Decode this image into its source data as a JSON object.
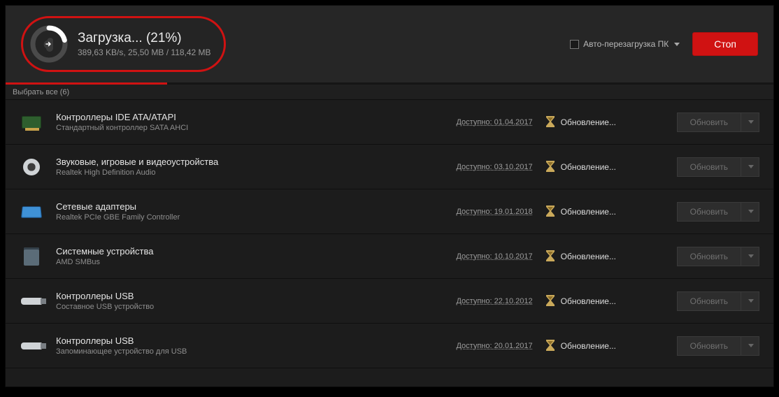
{
  "header": {
    "title": "Загрузка... (21%)",
    "meta": "389,63 KB/s, 25,50 MB / 118,42 MB",
    "progress_percent": 21,
    "auto_restart_label": "Авто-перезагрузка ПК",
    "stop_label": "Стоп"
  },
  "select_all": "Выбрать все (6)",
  "avail_prefix": "Доступно: ",
  "status_label": "Обновление...",
  "update_btn_label": "Обновить",
  "rows": [
    {
      "icon": "card",
      "title": "Контроллеры IDE ATA/ATAPI",
      "sub": "Стандартный контроллер SATA AHCI",
      "date": "01.04.2017"
    },
    {
      "icon": "speaker",
      "title": "Звуковые, игровые и видеоустройства",
      "sub": "Realtek High Definition Audio",
      "date": "03.10.2017"
    },
    {
      "icon": "nic",
      "title": "Сетевые адаптеры",
      "sub": "Realtek PCIe GBE Family Controller",
      "date": "19.01.2018"
    },
    {
      "icon": "sys",
      "title": "Системные устройства",
      "sub": "AMD SMBus",
      "date": "10.10.2017"
    },
    {
      "icon": "usb",
      "title": "Контроллеры USB",
      "sub": "Составное USB устройство",
      "date": "22.10.2012"
    },
    {
      "icon": "usb",
      "title": "Контроллеры USB",
      "sub": "Запоминающее устройство для USB",
      "date": "20.01.2017"
    }
  ]
}
